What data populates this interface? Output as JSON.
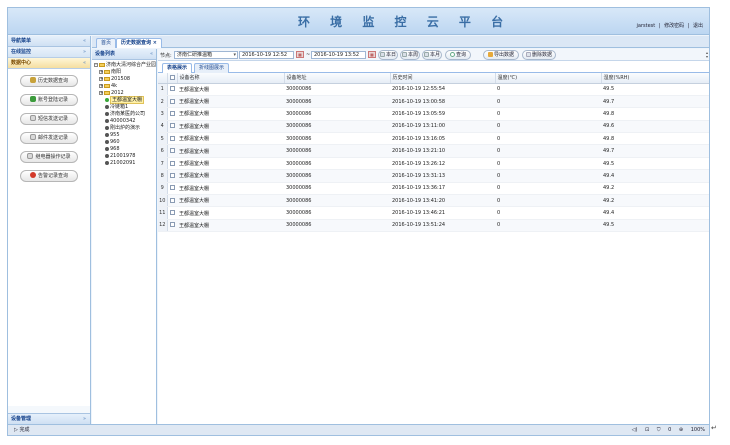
{
  "header": {
    "title": "环 境 监 控 云 平 台",
    "user": "jarstest",
    "links": [
      "修改密码",
      "退出"
    ],
    "separator": "|"
  },
  "leftnav": {
    "title": "导航菜单",
    "groups": [
      {
        "label": "在线监控"
      },
      {
        "label": "数据中心"
      }
    ],
    "buttons": [
      {
        "label": "历史数据查询",
        "icon": "history-icon",
        "color": "#c8a23a"
      },
      {
        "label": "账号登陆记录",
        "icon": "account-icon",
        "color": "#3c9b3c"
      },
      {
        "label": "短信发送记录",
        "icon": "sms-icon",
        "color": "#d9d9d9"
      },
      {
        "label": "邮件发送记录",
        "icon": "mail-icon",
        "color": "#d9d9d9"
      },
      {
        "label": "继电器操作记录",
        "icon": "relay-icon",
        "color": "#d9d9d9"
      },
      {
        "label": "告警记录查询",
        "icon": "alarm-icon",
        "color": "#d33a2a"
      }
    ],
    "footer": "设备管理",
    "chevron": "«",
    "chevron_down": "»"
  },
  "maintabs": [
    {
      "label": "首页"
    },
    {
      "label": "历史数据查询 ×"
    }
  ],
  "tree": {
    "title": "设备列表",
    "items": [
      {
        "label": "济南大清河综合产业园",
        "type": "folder",
        "pm": "-"
      },
      {
        "label": "南阳",
        "type": "folder",
        "pm": "+"
      },
      {
        "label": "201508",
        "type": "folder",
        "pm": "+"
      },
      {
        "label": "4k",
        "type": "folder",
        "pm": "+"
      },
      {
        "label": "2012",
        "type": "folder",
        "pm": "+"
      },
      {
        "label": "王都温室大棚",
        "type": "device-green",
        "selected": true
      },
      {
        "label": "冷链箱1",
        "type": "device"
      },
      {
        "label": "济南某医药公司",
        "type": "device"
      },
      {
        "label": "40000342",
        "type": "device"
      },
      {
        "label": "刚出炉的演示",
        "type": "device"
      },
      {
        "label": "955",
        "type": "device"
      },
      {
        "label": "960",
        "type": "device"
      },
      {
        "label": "968",
        "type": "device"
      },
      {
        "label": "21001978",
        "type": "device"
      },
      {
        "label": "21002091",
        "type": "device"
      }
    ]
  },
  "toolbar": {
    "node_label": "节点:",
    "node_value": "济南仁研推温箱",
    "dropdown_glyph": "▾",
    "start_time": "2016-10-19 12:52",
    "range_sep": "~",
    "end_time": "2016-10-19 13:52",
    "buttons": [
      {
        "label": "本日"
      },
      {
        "label": "本周"
      },
      {
        "label": "本月"
      },
      {
        "label": "查询"
      },
      {
        "label": "导出数据"
      },
      {
        "label": "删除数据"
      }
    ]
  },
  "subtabs": [
    {
      "label": "表格展示"
    },
    {
      "label": "折线图展示"
    }
  ],
  "table": {
    "columns": [
      "设备名称",
      "设备地址",
      "历史时间",
      "温度(℃)",
      "湿度(%RH)"
    ],
    "rows": [
      {
        "n": "1",
        "name": "王都温室大棚",
        "addr": "30000086",
        "time": "2016-10-19 12:55:54",
        "temp": "0",
        "hum": "49.5"
      },
      {
        "n": "2",
        "name": "王都温室大棚",
        "addr": "30000086",
        "time": "2016-10-19 13:00:58",
        "temp": "0",
        "hum": "49.7"
      },
      {
        "n": "3",
        "name": "王都温室大棚",
        "addr": "30000086",
        "time": "2016-10-19 13:05:59",
        "temp": "0",
        "hum": "49.8"
      },
      {
        "n": "4",
        "name": "王都温室大棚",
        "addr": "30000086",
        "time": "2016-10-19 13:11:00",
        "temp": "0",
        "hum": "49.6"
      },
      {
        "n": "5",
        "name": "王都温室大棚",
        "addr": "30000086",
        "time": "2016-10-19 13:16:05",
        "temp": "0",
        "hum": "49.8"
      },
      {
        "n": "6",
        "name": "王都温室大棚",
        "addr": "30000086",
        "time": "2016-10-19 13:21:10",
        "temp": "0",
        "hum": "49.7"
      },
      {
        "n": "7",
        "name": "王都温室大棚",
        "addr": "30000086",
        "time": "2016-10-19 13:26:12",
        "temp": "0",
        "hum": "49.5"
      },
      {
        "n": "8",
        "name": "王都温室大棚",
        "addr": "30000086",
        "time": "2016-10-19 13:31:13",
        "temp": "0",
        "hum": "49.4"
      },
      {
        "n": "9",
        "name": "王都温室大棚",
        "addr": "30000086",
        "time": "2016-10-19 13:36:17",
        "temp": "0",
        "hum": "49.2"
      },
      {
        "n": "10",
        "name": "王都温室大棚",
        "addr": "30000086",
        "time": "2016-10-19 13:41:20",
        "temp": "0",
        "hum": "49.2"
      },
      {
        "n": "11",
        "name": "王都温室大棚",
        "addr": "30000086",
        "time": "2016-10-19 13:46:21",
        "temp": "0",
        "hum": "49.4"
      },
      {
        "n": "12",
        "name": "王都温室大棚",
        "addr": "30000086",
        "time": "2016-10-19 13:51:24",
        "temp": "0",
        "hum": "49.5"
      }
    ]
  },
  "statusbar": {
    "status": "完成",
    "count": "0",
    "zoom": "100%"
  }
}
